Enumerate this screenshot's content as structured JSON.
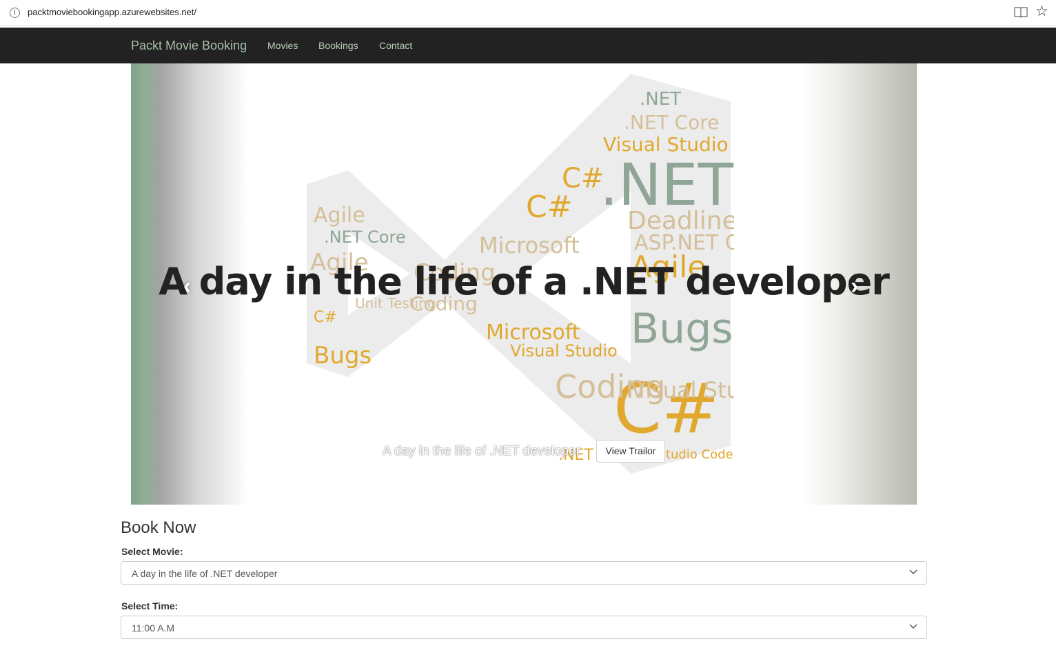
{
  "browser": {
    "url": "packtmoviebookingapp.azurewebsites.net/"
  },
  "navbar": {
    "brand": "Packt Movie Booking",
    "links": [
      {
        "label": "Movies"
      },
      {
        "label": "Bookings"
      },
      {
        "label": "Contact"
      }
    ]
  },
  "carousel": {
    "headline": "A day in the life of a .NET developer",
    "caption": "A day in the life of .NET developer",
    "button_label": "View Trailor",
    "prev_glyph": "‹",
    "next_glyph": "›",
    "wordcloud_words": [
      ".NET",
      ".NET Core",
      "Visual Studio",
      "C#",
      "Deadline",
      "Agile",
      "Coding",
      "Bugs",
      "Microsoft",
      "Unit Testing",
      "ASP.NET Core",
      "Visual Studio Code"
    ]
  },
  "booking": {
    "title": "Book Now",
    "movie_label": "Select Movie:",
    "movie_value": "A day in the life of .NET developer",
    "time_label": "Select Time:",
    "time_value": "11:00 A.M"
  },
  "colors": {
    "navbar_bg": "#222222",
    "brand": "#a6c0a6",
    "wordcloud_gold": "#e0a82e",
    "wordcloud_sage": "#8fa595",
    "wordcloud_tan": "#d4bf98"
  }
}
